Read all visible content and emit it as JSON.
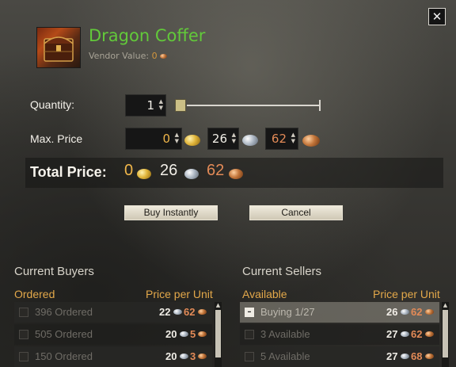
{
  "item": {
    "name": "Dragon Coffer",
    "vendor_label": "Vendor Value:",
    "vendor_value": "0"
  },
  "close_symbol": "✕",
  "quantity": {
    "label": "Quantity:",
    "value": "1"
  },
  "max_price": {
    "label": "Max. Price",
    "gold": "0",
    "silver": "26",
    "copper": "62"
  },
  "total_price": {
    "label": "Total Price:",
    "gold": "0",
    "silver": "26",
    "copper": "62"
  },
  "buttons": {
    "buy": "Buy Instantly",
    "cancel": "Cancel"
  },
  "buyers": {
    "title": "Current Buyers",
    "col_left": "Ordered",
    "col_right": "Price per Unit",
    "rows": [
      {
        "name": "396 Ordered",
        "silver": "22",
        "copper": "62"
      },
      {
        "name": "505 Ordered",
        "silver": "20",
        "copper": "5"
      },
      {
        "name": "150 Ordered",
        "silver": "20",
        "copper": "3"
      }
    ]
  },
  "sellers": {
    "title": "Current Sellers",
    "col_left": "Available",
    "col_right": "Price per Unit",
    "rows": [
      {
        "name": "Buying 1/27",
        "silver": "26",
        "copper": "62",
        "highlighted": true
      },
      {
        "name": "3 Available",
        "silver": "27",
        "copper": "62"
      },
      {
        "name": "5 Available",
        "silver": "27",
        "copper": "68"
      }
    ]
  },
  "colors": {
    "title": "#62c93a",
    "header_accent": "#e3a84a",
    "copper_text": "#e28a57",
    "gold_text": "#f0b64a"
  },
  "icons": [
    "close-icon",
    "dragon-coffer-icon",
    "gold-coin-icon",
    "silver-coin-icon",
    "copper-coin-icon",
    "minus-icon",
    "scroll-up-icon",
    "scroll-down-icon"
  ]
}
